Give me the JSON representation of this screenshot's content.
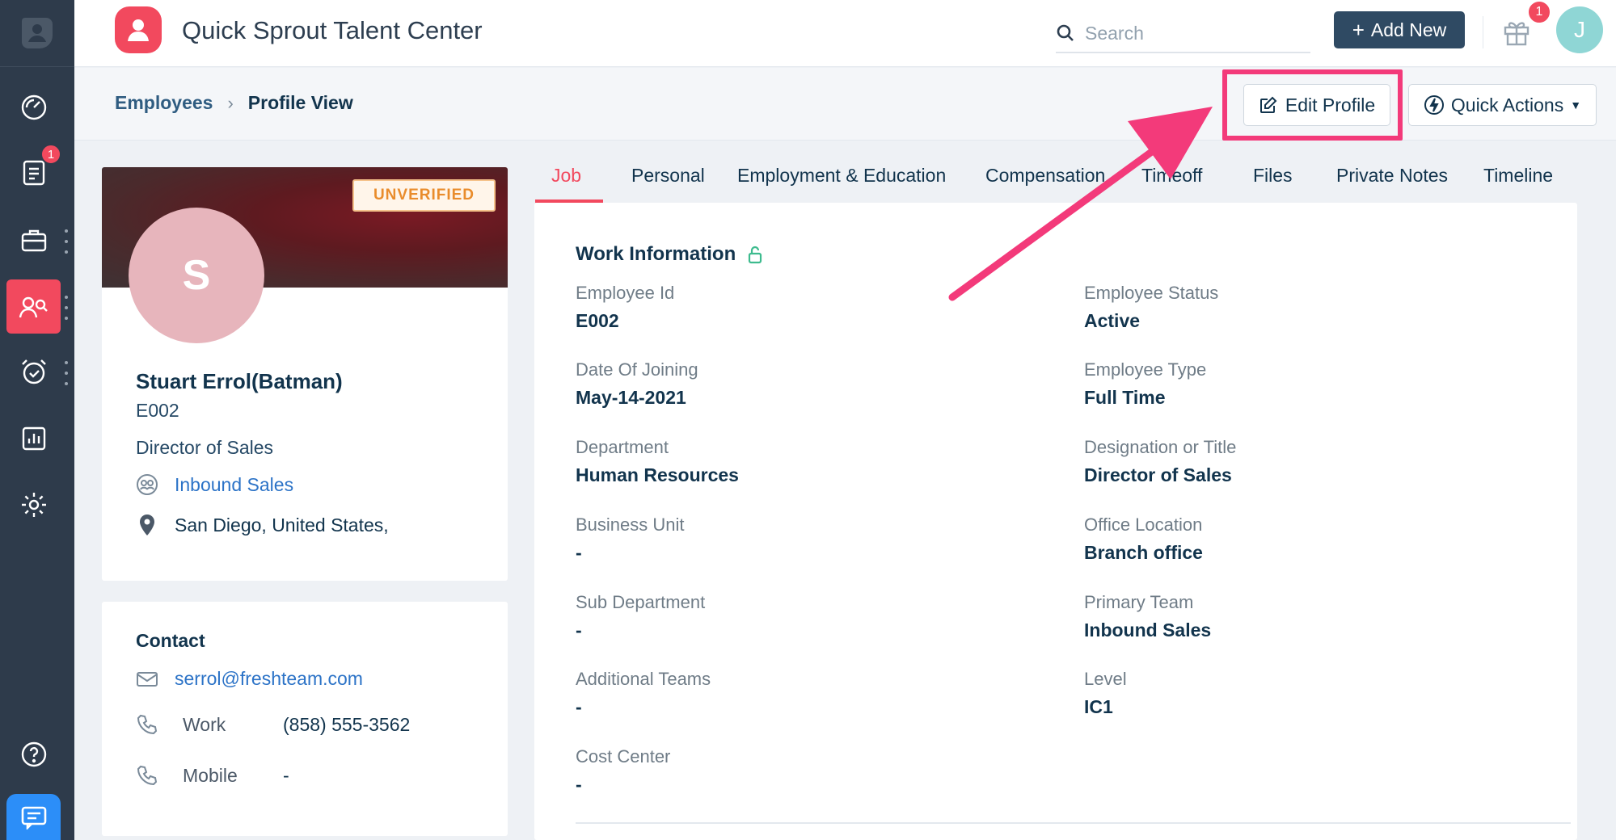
{
  "app": {
    "title": "Quick Sprout Talent Center"
  },
  "colors": {
    "accent": "#f2495e",
    "sidebar": "#2e3b4b",
    "highlight": "#f33a7a",
    "link": "#2c73c7"
  },
  "sidebar": {
    "icons": [
      "logo-icon",
      "dashboard-icon",
      "tasks-icon",
      "jobs-icon",
      "employees-icon",
      "timeoff-icon",
      "reports-icon",
      "settings-icon",
      "help-icon",
      "chat-icon"
    ],
    "tasks_badge": "1",
    "active": "employees"
  },
  "header": {
    "search_placeholder": "Search",
    "add_new_label": "Add New",
    "gift_badge": "1",
    "avatar_initial": "J"
  },
  "subheader": {
    "breadcrumb": {
      "parent": "Employees",
      "current": "Profile View"
    },
    "edit_profile_label": "Edit Profile",
    "quick_actions_label": "Quick Actions"
  },
  "profile": {
    "status_badge": "UNVERIFIED",
    "avatar_initial": "S",
    "name": "Stuart Errol(Batman)",
    "employee_id": "E002",
    "title": "Director of Sales",
    "team": "Inbound Sales",
    "location": "San Diego, United States,"
  },
  "contact": {
    "heading": "Contact",
    "email": "serrol@freshteam.com",
    "work_label": "Work",
    "work_phone": "(858) 555-3562",
    "mobile_label": "Mobile",
    "mobile_phone": "-"
  },
  "tabs": [
    "Job",
    "Personal",
    "Employment & Education",
    "Compensation",
    "Timeoff",
    "Files",
    "Private Notes",
    "Timeline"
  ],
  "work_info": {
    "title": "Work Information",
    "left": [
      {
        "label": "Employee Id",
        "value": "E002"
      },
      {
        "label": "Date Of Joining",
        "value": "May-14-2021"
      },
      {
        "label": "Department",
        "value": "Human Resources"
      },
      {
        "label": "Business Unit",
        "value": "-"
      },
      {
        "label": "Sub Department",
        "value": "-"
      },
      {
        "label": "Additional Teams",
        "value": "-"
      },
      {
        "label": "Cost Center",
        "value": "-"
      }
    ],
    "right": [
      {
        "label": "Employee Status",
        "value": "Active"
      },
      {
        "label": "Employee Type",
        "value": "Full Time"
      },
      {
        "label": "Designation or Title",
        "value": "Director of Sales"
      },
      {
        "label": "Office Location",
        "value": "Branch office"
      },
      {
        "label": "Primary Team",
        "value": "Inbound Sales"
      },
      {
        "label": "Level",
        "value": "IC1"
      }
    ]
  }
}
